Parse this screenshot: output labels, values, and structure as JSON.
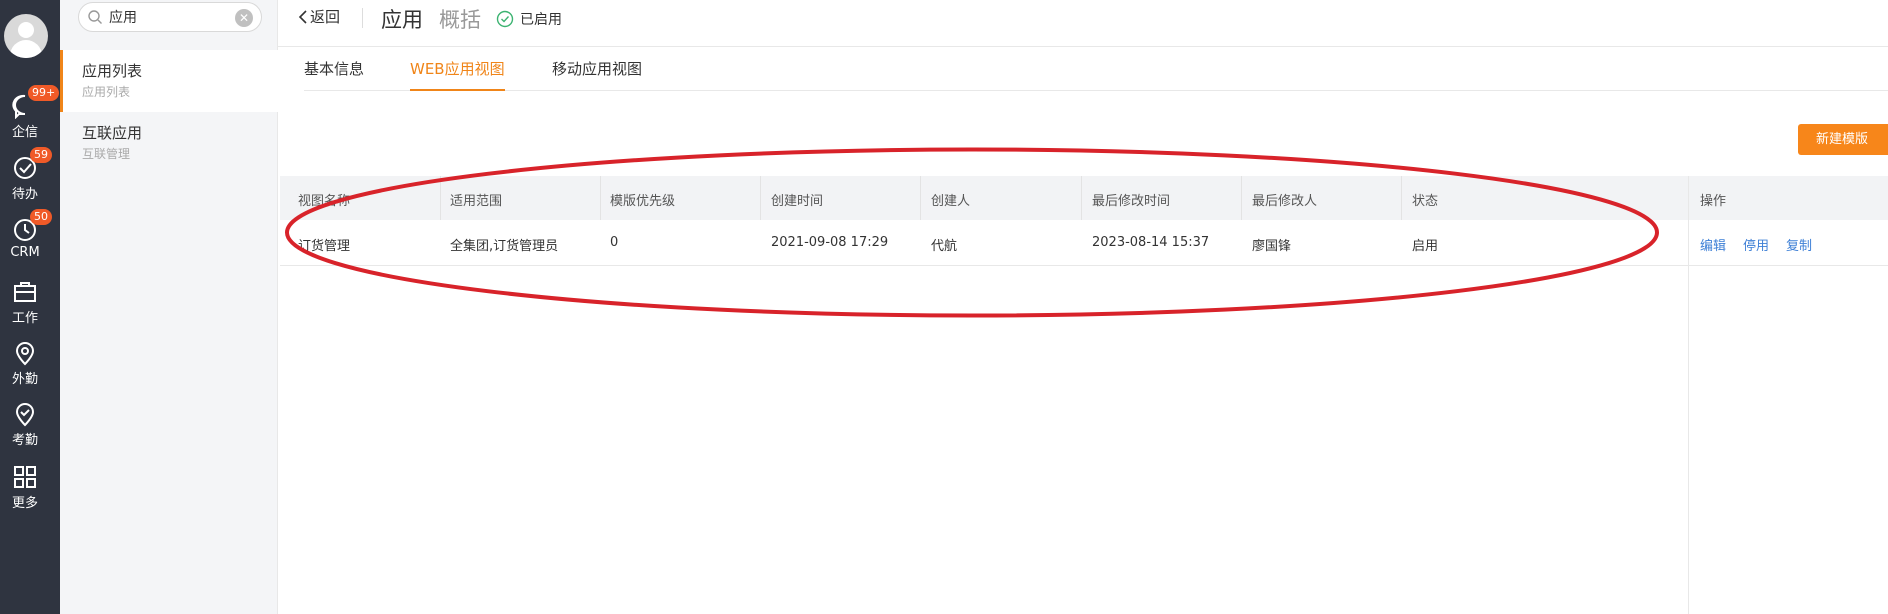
{
  "rail": {
    "items": [
      {
        "label": "企信",
        "badge": "99+",
        "icon": "chat-icon"
      },
      {
        "label": "待办",
        "badge": "59",
        "icon": "check-circle-icon"
      },
      {
        "label": "CRM",
        "badge": "50",
        "icon": "clock-icon"
      },
      {
        "label": "工作",
        "badge": "",
        "icon": "briefcase-icon"
      },
      {
        "label": "外勤",
        "badge": "",
        "icon": "location-pin-icon"
      },
      {
        "label": "考勤",
        "badge": "",
        "icon": "attendance-icon"
      },
      {
        "label": "更多",
        "badge": "",
        "icon": "grid-icon"
      }
    ]
  },
  "sidebar": {
    "search_value": "应用",
    "items": [
      {
        "title": "应用列表",
        "sub": "应用列表"
      },
      {
        "title": "互联应用",
        "sub": "互联管理"
      }
    ]
  },
  "header": {
    "back_label": "返回",
    "title": "应用",
    "subtitle": "概括",
    "status": "已启用"
  },
  "tabs": [
    "基本信息",
    "WEB应用视图",
    "移动应用视图"
  ],
  "new_button": "新建模版",
  "table": {
    "columns": [
      "视图名称",
      "适用范围",
      "模版优先级",
      "创建时间",
      "创建人",
      "最后修改时间",
      "最后修改人",
      "状态",
      "操作"
    ],
    "rows": [
      {
        "name": "订货管理",
        "scope": "全集团,订货管理员",
        "priority": "0",
        "created": "2021-09-08 17:29",
        "creator": "代航",
        "modified": "2023-08-14 15:37",
        "modifier": "廖国锋",
        "status": "启用",
        "ops": [
          "编辑",
          "停用",
          "复制"
        ]
      }
    ]
  },
  "colors": {
    "accent": "#f08519",
    "link": "#3d7fd6",
    "annotation": "#d8232a"
  }
}
